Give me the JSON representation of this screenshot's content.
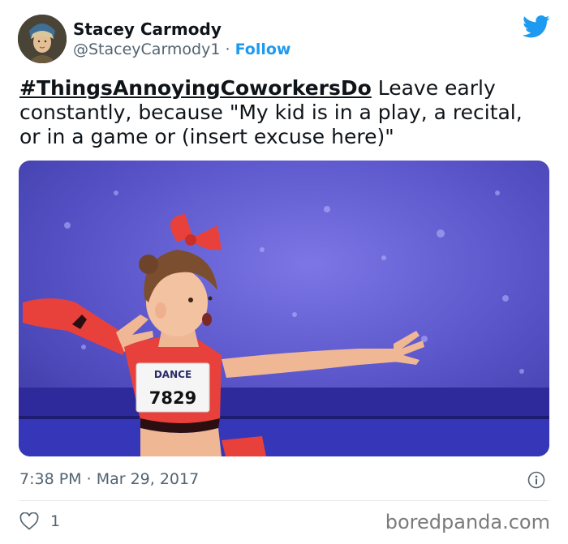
{
  "author": {
    "name": "Stacey Carmody",
    "handle": "@StaceyCarmody1",
    "separator": "·",
    "follow_label": "Follow"
  },
  "tweet": {
    "hashtag": "#ThingsAnnoyingCoworkersDo",
    "body": " Leave early constantly, because \"My kid is in a play,  a recital, or in a game or  (insert excuse here)\""
  },
  "media": {
    "bib_brand": "DANCE",
    "bib_number": "7829"
  },
  "meta": {
    "time": "7:38 PM",
    "separator": "·",
    "date": "Mar 29, 2017"
  },
  "engagement": {
    "likes": "1"
  },
  "watermark": "boredpanda.com",
  "icons": {
    "brand": "twitter-bird-icon",
    "info": "info-icon",
    "like": "heart-icon"
  },
  "colors": {
    "brand_blue": "#1d9bf0",
    "text_primary": "#0f1419",
    "text_secondary": "#536471",
    "stage_purple": "#5b55c9",
    "costume_red": "#e8413b"
  }
}
